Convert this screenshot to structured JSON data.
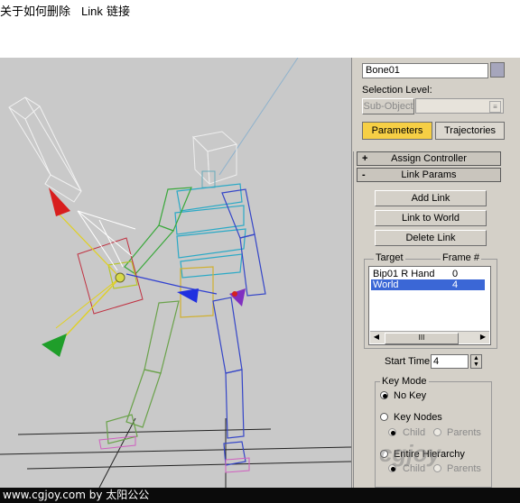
{
  "heading": {
    "title": "关于如何删除",
    "link_word": "Link",
    "suffix": "链接"
  },
  "footer": {
    "text": "www.cgjoy.com by 太阳公公"
  },
  "watermark": {
    "text": "cgjoy"
  },
  "panel": {
    "object_name": "Bone01",
    "swatch_color": "#a6a6bc",
    "selection_level_label": "Selection Level:",
    "sub_object_button": "Sub-Object",
    "tabs": {
      "parameters": "Parameters",
      "trajectories": "Trajectories"
    },
    "rollouts": {
      "assign_controller": "Assign Controller",
      "assign_sign": "+",
      "link_params": "Link Params",
      "link_sign": "-"
    },
    "buttons": {
      "add_link": "Add Link",
      "link_to_world": "Link to World",
      "delete_link": "Delete Link"
    },
    "list": {
      "col_target": "Target",
      "col_frame": "Frame #",
      "rows": [
        {
          "target": "Bip01 R Hand",
          "frame": "0"
        },
        {
          "target": "World",
          "frame": "4"
        }
      ],
      "scroll_thumb": "III"
    },
    "start_time_label": "Start Time:",
    "start_time_value": "4",
    "key_mode": {
      "title": "Key Mode",
      "no_key": "No Key",
      "key_nodes": "Key Nodes",
      "child": "Child",
      "parents": "Parents",
      "entire_hierarchy": "Entire Hierarchy",
      "child2": "Child",
      "parents2": "Parents"
    }
  }
}
